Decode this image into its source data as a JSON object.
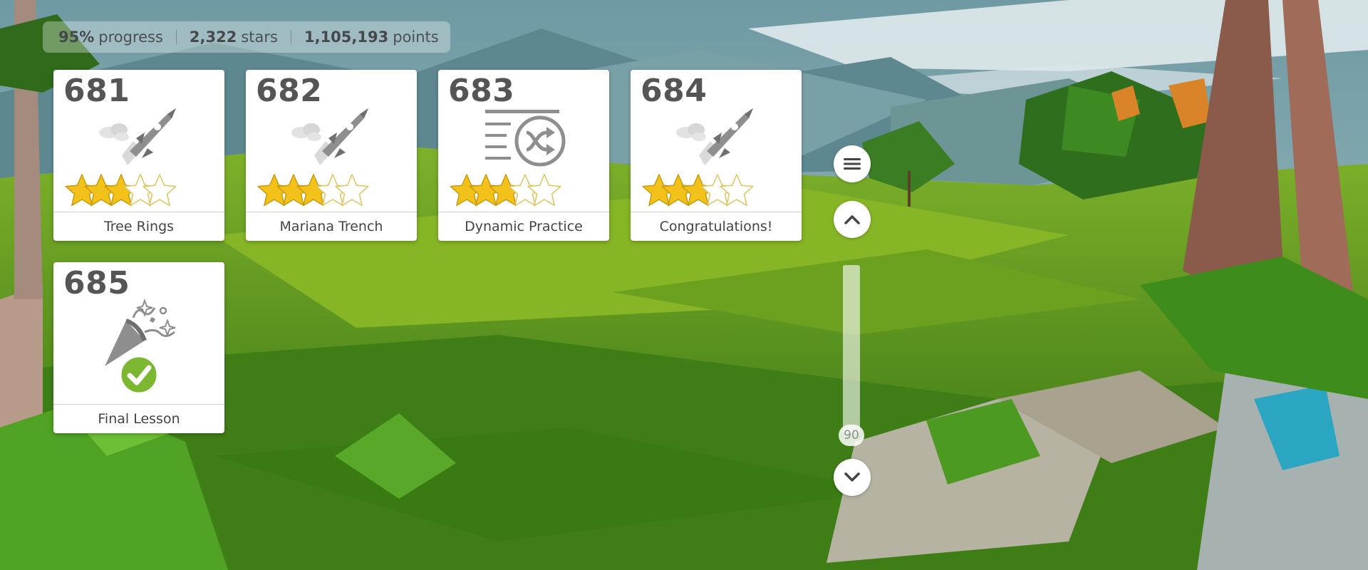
{
  "stats": {
    "progress_value": "95%",
    "progress_label": "progress",
    "stars_value": "2,322",
    "stars_label": "stars",
    "points_value": "1,105,193",
    "points_label": "points"
  },
  "lessons": [
    {
      "number": "681",
      "title": "Tree Rings",
      "icon": "rocket-icon",
      "stars": 3,
      "max_stars": 5
    },
    {
      "number": "682",
      "title": "Mariana Trench",
      "icon": "rocket-icon",
      "stars": 3,
      "max_stars": 5
    },
    {
      "number": "683",
      "title": "Dynamic Practice",
      "icon": "shuffle-practice-icon",
      "stars": 3,
      "max_stars": 5
    },
    {
      "number": "684",
      "title": "Congratulations!",
      "icon": "rocket-icon",
      "stars": 3,
      "max_stars": 5
    },
    {
      "number": "685",
      "title": "Final Lesson",
      "icon": "party-popper-icon",
      "completed": true
    }
  ],
  "controls": {
    "menu_icon": "menu-icon",
    "up_icon": "chevron-up-icon",
    "down_icon": "chevron-down-icon",
    "scroll_value": "90"
  },
  "colors": {
    "star_fill": "#f3c21a",
    "star_empty": "#ffffff",
    "check_green": "#7cb82f",
    "icon_gray": "#8e8e8e"
  }
}
